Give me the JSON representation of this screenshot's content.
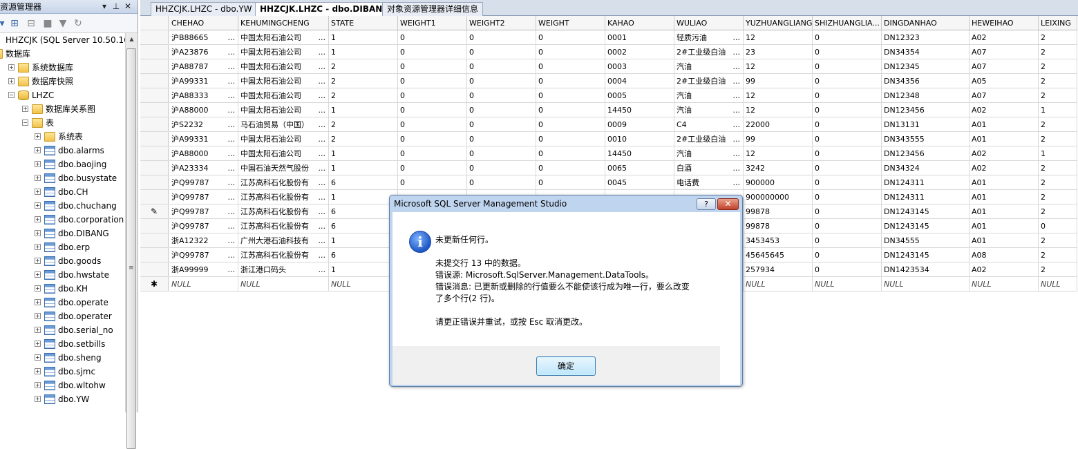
{
  "explorer": {
    "title": "资源管理器",
    "pin": "▾ ⊕",
    "close": "✕",
    "tree": [
      {
        "label": "HHZCJK (SQL Server 10.50.16",
        "icon": "server-icon",
        "level": 0
      },
      {
        "label": "数据库",
        "icon": "folder-icon",
        "level": 0,
        "expanded": true
      },
      {
        "label": "系统数据库",
        "icon": "folder-icon",
        "level": 1
      },
      {
        "label": "数据库快照",
        "icon": "folder-icon",
        "level": 1
      },
      {
        "label": "LHZC",
        "icon": "database-icon",
        "level": 1,
        "expanded": true
      },
      {
        "label": "数据库关系图",
        "icon": "folder-icon",
        "level": 2
      },
      {
        "label": "表",
        "icon": "folder-icon",
        "level": 2,
        "expanded": true
      },
      {
        "label": "系统表",
        "icon": "folder-icon",
        "level": 3
      },
      {
        "label": "dbo.alarms",
        "icon": "table-icon",
        "level": 3
      },
      {
        "label": "dbo.baojing",
        "icon": "table-icon",
        "level": 3
      },
      {
        "label": "dbo.busystate",
        "icon": "table-icon",
        "level": 3
      },
      {
        "label": "dbo.CH",
        "icon": "table-icon",
        "level": 3
      },
      {
        "label": "dbo.chuchang",
        "icon": "table-icon",
        "level": 3
      },
      {
        "label": "dbo.corporation",
        "icon": "table-icon",
        "level": 3
      },
      {
        "label": "dbo.DIBANG",
        "icon": "table-icon",
        "level": 3
      },
      {
        "label": "dbo.erp",
        "icon": "table-icon",
        "level": 3
      },
      {
        "label": "dbo.goods",
        "icon": "table-icon",
        "level": 3
      },
      {
        "label": "dbo.hwstate",
        "icon": "table-icon",
        "level": 3
      },
      {
        "label": "dbo.KH",
        "icon": "table-icon",
        "level": 3
      },
      {
        "label": "dbo.operate",
        "icon": "table-icon",
        "level": 3
      },
      {
        "label": "dbo.operater",
        "icon": "table-icon",
        "level": 3
      },
      {
        "label": "dbo.serial_no",
        "icon": "table-icon",
        "level": 3
      },
      {
        "label": "dbo.setbills",
        "icon": "table-icon",
        "level": 3
      },
      {
        "label": "dbo.sheng",
        "icon": "table-icon",
        "level": 3
      },
      {
        "label": "dbo.sjmc",
        "icon": "table-icon",
        "level": 3
      },
      {
        "label": "dbo.wltohw",
        "icon": "table-icon",
        "level": 3
      },
      {
        "label": "dbo.YW",
        "icon": "table-icon",
        "level": 3
      }
    ]
  },
  "tabs": [
    {
      "label": "HHZCJK.LHZC - dbo.YW",
      "active": false
    },
    {
      "label": "HHZCJK.LHZC - dbo.DIBANG",
      "active": true
    },
    {
      "label": "对象资源管理器详细信息",
      "active": false
    }
  ],
  "grid": {
    "columns": [
      "CHEHAO",
      "KEHUMINGCHENG",
      "STATE",
      "WEIGHT1",
      "WEIGHT2",
      "WEIGHT",
      "KAHAO",
      "WULIAO",
      "YUZHUANGLIANG",
      "SHIZHUANGLIA...",
      "DINGDANHAO",
      "HEWEIHAO",
      "LEIXING"
    ],
    "rows": [
      [
        "沪B88665",
        "中国太阳石油公司",
        "1",
        "0",
        "0",
        "0",
        "0001",
        "轻质污油",
        "12",
        "0",
        "DN12323",
        "A02",
        "2"
      ],
      [
        "沪A23876",
        "中国太阳石油公司",
        "1",
        "0",
        "0",
        "0",
        "0002",
        "2#工业级白油",
        "23",
        "0",
        "DN34354",
        "A07",
        "2"
      ],
      [
        "沪A88787",
        "中国太阳石油公司",
        "2",
        "0",
        "0",
        "0",
        "0003",
        "汽油",
        "12",
        "0",
        "DN12345",
        "A07",
        "2"
      ],
      [
        "沪A99331",
        "中国太阳石油公司",
        "2",
        "0",
        "0",
        "0",
        "0004",
        "2#工业级白油",
        "99",
        "0",
        "DN34356",
        "A05",
        "2"
      ],
      [
        "沪A88333",
        "中国太阳石油公司",
        "2",
        "0",
        "0",
        "0",
        "0005",
        "汽油",
        "12",
        "0",
        "DN12348",
        "A07",
        "2"
      ],
      [
        "沪A88000",
        "中国太阳石油公司",
        "1",
        "0",
        "0",
        "0",
        "14450",
        "汽油",
        "12",
        "0",
        "DN123456",
        "A02",
        "1"
      ],
      [
        "沪S2232",
        "马石油贸易（中国）",
        "2",
        "0",
        "0",
        "0",
        "0009",
        "C4",
        "22000",
        "0",
        "DN13131",
        "A01",
        "2"
      ],
      [
        "沪A99331",
        "中国太阳石油公司",
        "2",
        "0",
        "0",
        "0",
        "0010",
        "2#工业级白油",
        "99",
        "0",
        "DN343555",
        "A01",
        "2"
      ],
      [
        "沪A88000",
        "中国太阳石油公司",
        "1",
        "0",
        "0",
        "0",
        "14450",
        "汽油",
        "12",
        "0",
        "DN123456",
        "A02",
        "1"
      ],
      [
        "沪A23334",
        "中国石油天然气股份",
        "1",
        "0",
        "0",
        "0",
        "0065",
        "白酒",
        "3242",
        "0",
        "DN34324",
        "A02",
        "2"
      ],
      [
        "沪Q99787",
        "江苏高科石化股份有",
        "6",
        "0",
        "0",
        "0",
        "0045",
        "电话费",
        "900000",
        "0",
        "DN124311",
        "A01",
        "2"
      ],
      [
        "沪Q99787",
        "江苏高科石化股份有",
        "1",
        "",
        "",
        "",
        "",
        "",
        "900000000",
        "0",
        "DN124311",
        "A01",
        "2"
      ],
      [
        "沪Q99787",
        "江苏高科石化股份有",
        "6",
        "",
        "",
        "",
        "",
        "",
        "99878",
        "0",
        "DN1243145",
        "A01",
        "2"
      ],
      [
        "沪Q99787",
        "江苏高科石化股份有",
        "6",
        "",
        "",
        "",
        "",
        "",
        "99878",
        "0",
        "DN1243145",
        "A01",
        "0"
      ],
      [
        "浙A12322",
        "广州大港石油科技有",
        "1",
        "",
        "",
        "",
        "",
        "",
        "3453453",
        "0",
        "DN34555",
        "A01",
        "2"
      ],
      [
        "沪Q99787",
        "江苏高科石化股份有",
        "6",
        "",
        "",
        "",
        "",
        "",
        "45645645",
        "0",
        "DN1243145",
        "A08",
        "2"
      ],
      [
        "浙A99999",
        "浙江港口码头",
        "1",
        "",
        "",
        "",
        "",
        "",
        "257934",
        "0",
        "DN1423534",
        "A02",
        "2"
      ]
    ],
    "ellipsis": "...",
    "null_text": "NULL",
    "new_row_marker": "✱",
    "edit_row_marker": "✎"
  },
  "dialog": {
    "title": "Microsoft SQL Server Management Studio",
    "help": "?",
    "close": "✕",
    "icon_glyph": "i",
    "line1": "未更新任何行。",
    "line2": "未提交行 13 中的数据。",
    "line3": "错误源: Microsoft.SqlServer.Management.DataTools。",
    "line4": "错误消息: 已更新或删除的行值要么不能使该行成为唯一行，要么改变",
    "line5": "了多个行(2 行)。",
    "line6": "请更正错误并重试，或按 Esc 取消更改。",
    "ok": "确定"
  }
}
